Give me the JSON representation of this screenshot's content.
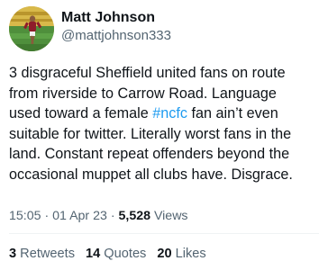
{
  "author": {
    "display_name": "Matt Johnson",
    "handle": "@mattjohnson333",
    "avatar_icon": "profile-photo-footballer"
  },
  "tweet": {
    "text_before_hashtag": "3 disgraceful Sheffield united fans on route from riverside to Carrow Road. Language used toward a female ",
    "hashtag": "#ncfc",
    "text_after_hashtag": " fan ain’t even suitable for twitter. Literally worst fans in the land. Constant repeat offenders beyond the occasional muppet all clubs have. Disgrace."
  },
  "meta": {
    "time": "15:05",
    "separator_1": " · ",
    "date": "01 Apr 23",
    "separator_2": " · ",
    "views_count": "5,528",
    "views_label": " Views"
  },
  "stats": {
    "retweets_count": "3",
    "retweets_label": " Retweets",
    "quotes_count": "14",
    "quotes_label": " Quotes",
    "likes_count": "20",
    "likes_label": " Likes"
  },
  "colors": {
    "text_primary": "#0f1419",
    "text_secondary": "#536471",
    "hashtag": "#1d9bf0",
    "divider": "#eff3f4"
  }
}
